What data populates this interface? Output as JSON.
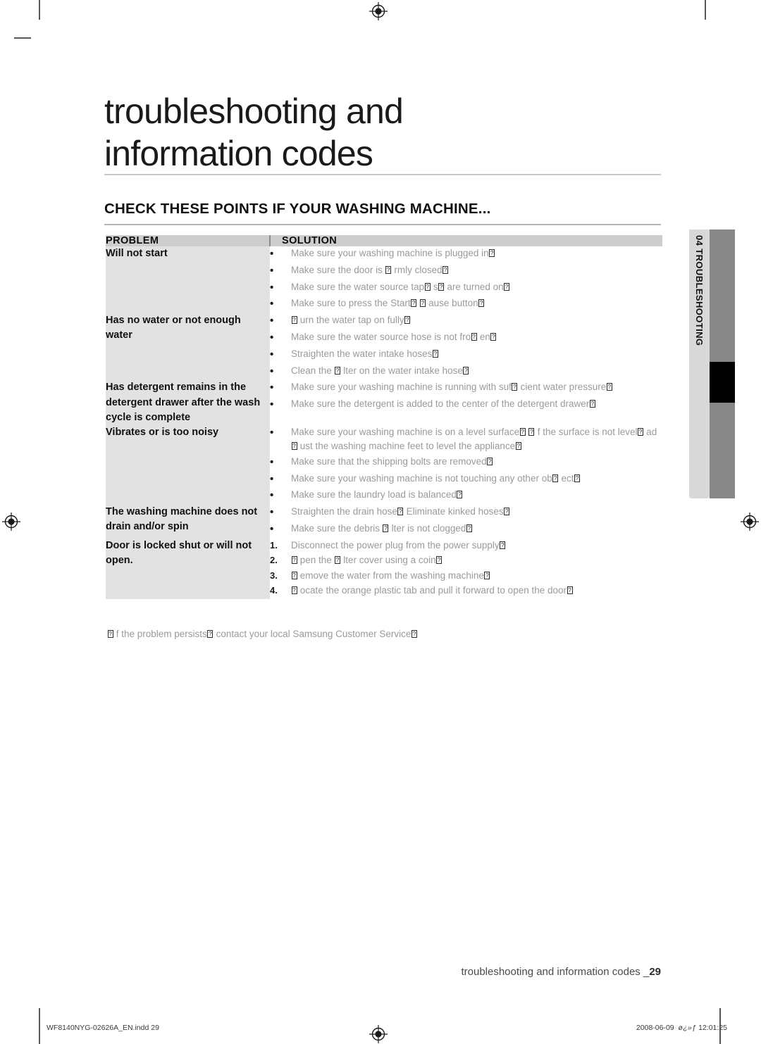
{
  "document": {
    "chapter_title_line1": "troubleshooting and",
    "chapter_title_line2": "information codes",
    "section_heading": "CHECK THESE POINTS IF YOUR WASHING MACHINE...",
    "footer_text": "troubleshooting and information codes _",
    "page_number": "29"
  },
  "side_tab": {
    "label": "04 TROUBLESHOOTING",
    "panel_color": "#d8d8d8",
    "bar_color": "#878787",
    "active_color": "#000000"
  },
  "table": {
    "header": {
      "problem": "PROBLEM",
      "solution": "SOLUTION"
    },
    "header_bg": "#cdcdcd",
    "problem_bg": "#e2e2e2",
    "solution_bg": "#ffffff",
    "rule_color": "#8c8c8c",
    "rows": [
      {
        "problem": "Will not start",
        "marker_type": "bullet",
        "solutions": [
          "Make sure your washing machine is plugged in□",
          "Make sure the door is □ rmly closed□",
          "Make sure the water source tap□ s□  are turned on□",
          "Make sure to press the Start□ □ ause button□"
        ]
      },
      {
        "problem": "Has no water or not enough water",
        "marker_type": "bullet",
        "solutions": [
          "□ urn the water tap on fully□",
          "Make sure the water source hose is not fro□ en□",
          "Straighten the water intake hoses□",
          "Clean the □ lter on the water intake hose□"
        ]
      },
      {
        "problem": "Has detergent remains in the detergent drawer after the wash cycle is complete",
        "marker_type": "bullet",
        "solutions": [
          "Make sure your washing machine is running with suf□ cient water pressure□",
          "Make sure the detergent is added to the center of the detergent drawer□"
        ]
      },
      {
        "problem": "Vibrates or is too noisy",
        "marker_type": "bullet",
        "solutions": [
          "Make sure your washing machine is on a level surface□  □ f the surface is not level□  ad□ ust the washing machine feet to level the appliance□",
          "Make sure that the shipping bolts are removed□",
          "Make sure your washing machine is not touching any other ob□ ect□",
          "Make sure the laundry load is balanced□"
        ]
      },
      {
        "problem": "The washing machine does not drain and/or spin",
        "marker_type": "bullet",
        "solutions": [
          "Straighten the drain hose□  Eliminate kinked hoses□",
          "Make sure the debris □ lter is not clogged□"
        ]
      },
      {
        "problem": "Door is locked shut or will not open.",
        "marker_type": "number",
        "solutions": [
          "Disconnect the power plug from the power supply□",
          "□ pen the □ lter cover using a coin□",
          "□ emove the water from the washing machine□",
          "□ ocate the orange plastic tab and pull it forward to open the door□"
        ]
      }
    ],
    "note": "□ f the problem persists□  contact your local Samsung Customer Service□"
  },
  "print_marks": {
    "file_name": "WF8140NYG-02626A_EN.indd   29",
    "date": "2008-06-09",
    "locale_marker": "ø¿»ƒ",
    "time": "12:01:25"
  }
}
